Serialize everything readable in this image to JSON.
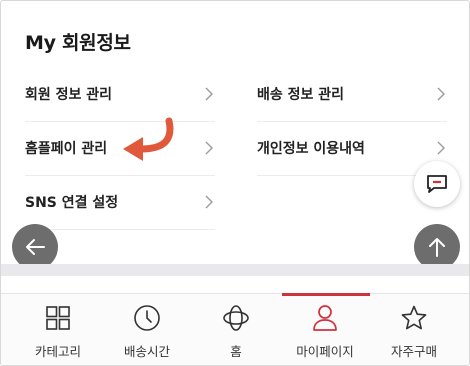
{
  "section": {
    "title": "My 회원정보"
  },
  "menu": {
    "left": [
      {
        "label": "회원 정보 관리"
      },
      {
        "label": "홈플페이 관리"
      },
      {
        "label": "SNS 연결 설정"
      }
    ],
    "right": [
      {
        "label": "배송 정보 관리"
      },
      {
        "label": "개인정보 이용내역"
      }
    ]
  },
  "annotation": {
    "color": "#e0593a",
    "icon": "curved-arrow-left-icon"
  },
  "floating": {
    "back_icon": "arrow-left-icon",
    "top_icon": "arrow-up-icon",
    "chat_icon": "chat-bubble-icon"
  },
  "bottom_nav": {
    "active_index": 3,
    "active_color": "#d0323d",
    "tabs": [
      {
        "label": "카테고리",
        "icon": "grid-icon"
      },
      {
        "label": "배송시간",
        "icon": "clock-icon"
      },
      {
        "label": "홈",
        "icon": "globe-home-icon"
      },
      {
        "label": "마이페이지",
        "icon": "user-icon"
      },
      {
        "label": "자주구매",
        "icon": "star-icon"
      }
    ]
  }
}
